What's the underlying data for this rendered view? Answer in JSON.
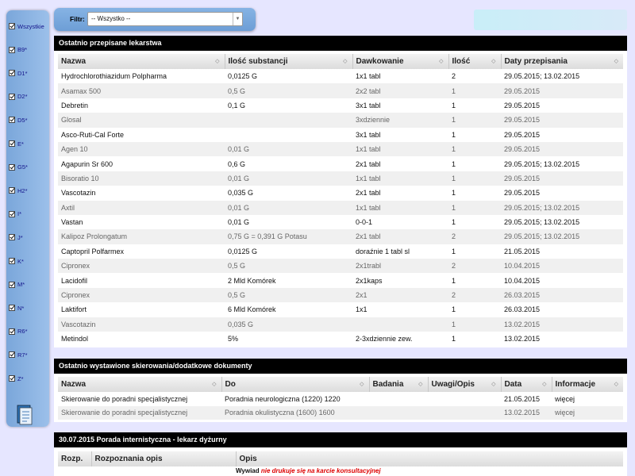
{
  "sidebar": {
    "items": [
      "Wszystkie",
      "B9*",
      "D1*",
      "D2*",
      "D5*",
      "E*",
      "G5*",
      "H2*",
      "I*",
      "J*",
      "K*",
      "M*",
      "N*",
      "R6*",
      "R7*",
      "Z*"
    ],
    "doc_icon": "document-icon"
  },
  "filter": {
    "label": "Filtr:",
    "value": "-- Wszystko --"
  },
  "medications": {
    "title": "Ostatnio przepisane lekarstwa",
    "headers": [
      "Nazwa",
      "Ilość substancji",
      "Dawkowanie",
      "Ilość",
      "Daty przepisania"
    ],
    "rows": [
      [
        "Hydrochlorothiazidum Polpharma",
        "0,0125 G",
        "1x1 tabl",
        "2",
        "29.05.2015; 13.02.2015"
      ],
      [
        "Asamax 500",
        "0,5 G",
        "2x2 tabl",
        "1",
        "29.05.2015"
      ],
      [
        "Debretin",
        "0,1 G",
        "3x1 tabl",
        "1",
        "29.05.2015"
      ],
      [
        "Glosal",
        "",
        "3xdziennie",
        "1",
        "29.05.2015"
      ],
      [
        "Asco-Ruti-Cal Forte",
        "",
        "3x1 tabl",
        "1",
        "29.05.2015"
      ],
      [
        "Agen 10",
        "0,01 G",
        "1x1 tabl",
        "1",
        "29.05.2015"
      ],
      [
        "Agapurin Sr 600",
        "0,6 G",
        "2x1 tabl",
        "1",
        "29.05.2015; 13.02.2015"
      ],
      [
        "Bisoratio 10",
        "0,01 G",
        "1x1 tabl",
        "1",
        "29.05.2015"
      ],
      [
        "Vascotazin",
        "0,035 G",
        "2x1 tabl",
        "1",
        "29.05.2015"
      ],
      [
        "Axtil",
        "0,01 G",
        "1x1 tabl",
        "1",
        "29.05.2015; 13.02.2015"
      ],
      [
        "Vastan",
        "0,01 G",
        "0-0-1",
        "1",
        "29.05.2015; 13.02.2015"
      ],
      [
        "Kalipoz Prolongatum",
        "0,75 G = 0,391 G Potasu",
        "2x1 tabl",
        "2",
        "29.05.2015; 13.02.2015"
      ],
      [
        "Captopril Polfarmex",
        "0,0125 G",
        "doraźnie 1 tabl sl",
        "1",
        "21.05.2015"
      ],
      [
        "Cipronex",
        "0,5 G",
        "2x1trabl",
        "2",
        "10.04.2015"
      ],
      [
        "Lacidofil",
        "2 Mld Komórek",
        "2x1kaps",
        "1",
        "10.04.2015"
      ],
      [
        "Cipronex",
        "0,5 G",
        "2x1",
        "2",
        "26.03.2015"
      ],
      [
        "Laktifort",
        "6 Mld Komórek",
        "1x1",
        "1",
        "26.03.2015"
      ],
      [
        "Vascotazin",
        "0,035 G",
        "",
        "1",
        "13.02.2015"
      ],
      [
        "Metindol",
        "5%",
        "2-3xdziennie zew.",
        "1",
        "13.02.2015"
      ]
    ]
  },
  "referrals": {
    "title": "Ostatnio wystawione skierowania/dodatkowe dokumenty",
    "headers": [
      "Nazwa",
      "Do",
      "Badania",
      "Uwagi/Opis",
      "Data",
      "Informacje"
    ],
    "rows": [
      [
        "Skierowanie do poradni specjalistycznej",
        "Poradnia neurologiczna (1220) 1220",
        "",
        "",
        "21.05.2015",
        "więcej"
      ],
      [
        "Skierowanie do poradni specjalistycznej",
        "Poradnia okulistyczna (1600) 1600",
        "",
        "",
        "13.02.2015",
        "więcej"
      ]
    ]
  },
  "visit": {
    "title": "30.07.2015 Porada internistyczna - lekarz dyżurny",
    "headers": [
      "Rozp.",
      "Rozpoznania opis",
      "Opis"
    ],
    "opis_label": "Wywiad",
    "opis_note": "nie drukuje się na karcie konsultacyjnej"
  },
  "colors": {
    "background": "#e6e6ff",
    "sidebar": "#8ab2e0",
    "section_header": "#000000",
    "note_red": "#dd0000"
  }
}
